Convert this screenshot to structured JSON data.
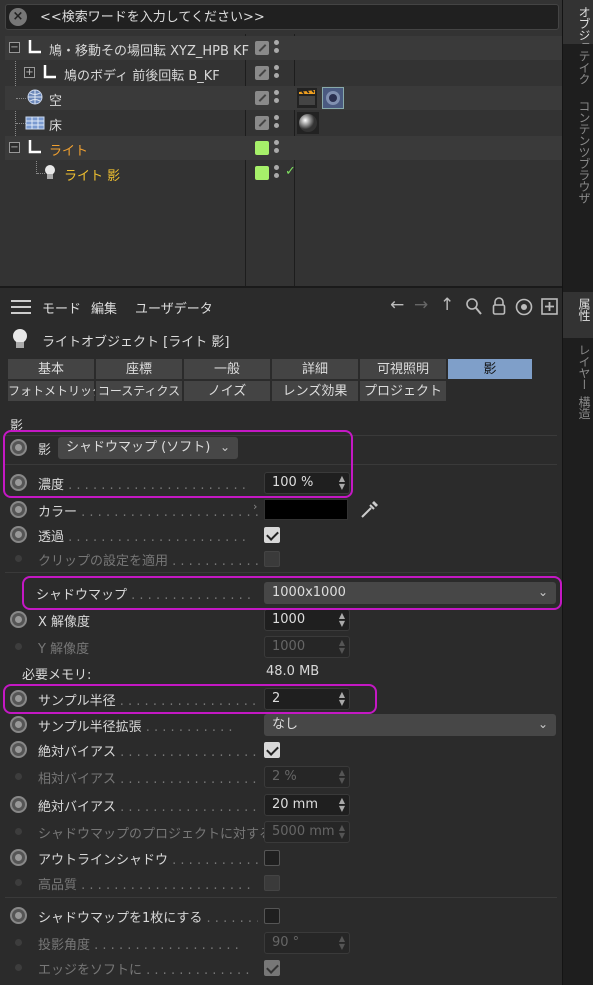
{
  "search": {
    "placeholder": "<<検索ワードを入力してください>>"
  },
  "side_tabs": [
    {
      "label": "オブジェクト",
      "active": true
    },
    {
      "label": "テイク",
      "active": false
    },
    {
      "label": "コンテンツブラウザ",
      "active": false
    },
    {
      "label": "属性",
      "active": true
    },
    {
      "label": "レイヤー",
      "active": false
    },
    {
      "label": "構造",
      "active": false
    }
  ],
  "objects": [
    {
      "name": "鳩・移動その場回転 XYZ_HPB KF",
      "color": "#d8d8d8"
    },
    {
      "name": "鳩のボディ 前後回転 B_KF",
      "color": "#d8d8d8"
    },
    {
      "name": "空",
      "color": "#d8d8d8"
    },
    {
      "name": "床",
      "color": "#d8d8d8"
    },
    {
      "name": "ライト",
      "color": "#f0a030"
    },
    {
      "name": "ライト 影",
      "color": "#f0c030"
    }
  ],
  "menu": {
    "mode": "モード",
    "edit": "編集",
    "userdata": "ユーザデータ"
  },
  "object_title": "ライトオブジェクト [ライト 影]",
  "tabs_row1": [
    "基本",
    "座標",
    "一般",
    "詳細",
    "可視照明",
    "影"
  ],
  "tabs_row2": [
    "フォトメトリック",
    "コースティクス",
    "ノイズ",
    "レンズ効果",
    "プロジェクト"
  ],
  "active_tab": "影",
  "section": "影",
  "props": {
    "shadow": {
      "label": "影",
      "value": "シャドウマップ (ソフト)"
    },
    "density": {
      "label": "濃度",
      "value": "100 %"
    },
    "color": {
      "label": "カラー",
      "value": "#000000"
    },
    "transparency": {
      "label": "透過",
      "checked": true
    },
    "clip": {
      "label": "クリップの設定を適用",
      "checked": false
    },
    "shadowmap": {
      "label": "シャドウマップ",
      "value": "1000x1000"
    },
    "xres": {
      "label": "X 解像度",
      "value": "1000"
    },
    "yres": {
      "label": "Y 解像度",
      "value": "1000"
    },
    "memory": {
      "label": "必要メモリ:",
      "value": "48.0 MB"
    },
    "sample_radius": {
      "label": "サンプル半径",
      "value": "2"
    },
    "sample_radius_ext": {
      "label": "サンプル半径拡張",
      "value": "なし"
    },
    "abs_bias": {
      "label": "絶対バイアス",
      "checked": true
    },
    "rel_bias": {
      "label": "相対バイアス",
      "value": "2 %"
    },
    "abs_bias2": {
      "label": "絶対バイアス",
      "value": "20 mm"
    },
    "proj_size": {
      "label": "シャドウマップのプロジェクトに対する大きさ",
      "value": "5000 mm"
    },
    "outline": {
      "label": "アウトラインシャドウ",
      "checked": false
    },
    "hq": {
      "label": "高品質",
      "checked": false
    },
    "single_map": {
      "label": "シャドウマップを1枚にする",
      "checked": false
    },
    "proj_angle": {
      "label": "投影角度",
      "value": "90 °"
    },
    "soft_edge": {
      "label": "エッジをソフトに",
      "checked": true
    }
  },
  "highlight_color": "#c418c4"
}
